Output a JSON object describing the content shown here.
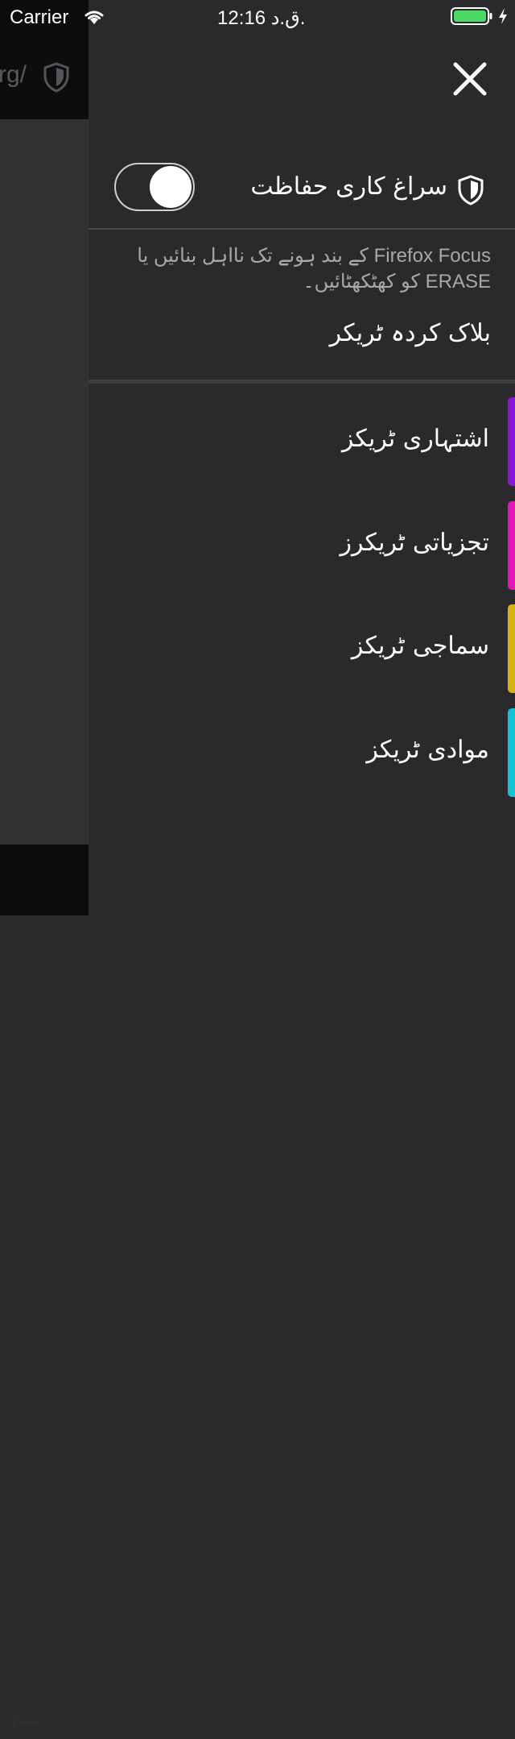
{
  "status_bar": {
    "carrier": "Carrier",
    "time": "12:16 ق.د."
  },
  "background": {
    "url_fragment": "rg/"
  },
  "panel": {
    "tracking_protection": {
      "label": "سراغ کاری حفاظت",
      "enabled": true
    },
    "description": "Firefox Focus کے بند ہونے تک نااہل بنائیں یا ERASE کو کھٹکھٹائیں۔",
    "blocked_title": "بلاک کردہ ٹریکر",
    "trackers": [
      {
        "label": "اشتہاری ٹریکز",
        "color": "#8a16d9"
      },
      {
        "label": "تجزیاتی ٹریکرز",
        "color": "#e414b8"
      },
      {
        "label": "سماجی ٹریکز",
        "color": "#d4b40c"
      },
      {
        "label": "موادی ٹریکز",
        "color": "#12c3d6"
      }
    ]
  },
  "colors": {
    "battery": "#4cd964",
    "panel_bg": "#2a2a2c"
  }
}
